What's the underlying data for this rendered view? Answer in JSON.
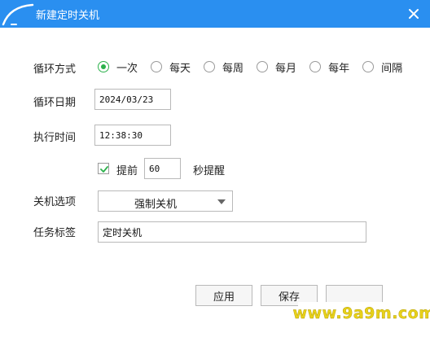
{
  "window": {
    "title": "新建定时关机"
  },
  "form": {
    "cycle_mode": {
      "label": "循环方式",
      "options": [
        "一次",
        "每天",
        "每周",
        "每月",
        "每年",
        "间隔"
      ],
      "selected": "一次"
    },
    "cycle_date": {
      "label": "循环日期",
      "value": "2024/03/23"
    },
    "exec_time": {
      "label": "执行时间",
      "value": "12:38:30"
    },
    "remind": {
      "checked": true,
      "prefix": "提前",
      "value": "60",
      "suffix": "秒提醒"
    },
    "shutdown_option": {
      "label": "关机选项",
      "value": "强制关机"
    },
    "task_tag": {
      "label": "任务标签",
      "value": "定时关机"
    }
  },
  "buttons": {
    "apply": "应用",
    "save": "保存"
  },
  "watermark": "www.9a9m.com",
  "colors": {
    "titlebar": "#2a8ff0",
    "accent_green": "#2bb14b"
  }
}
